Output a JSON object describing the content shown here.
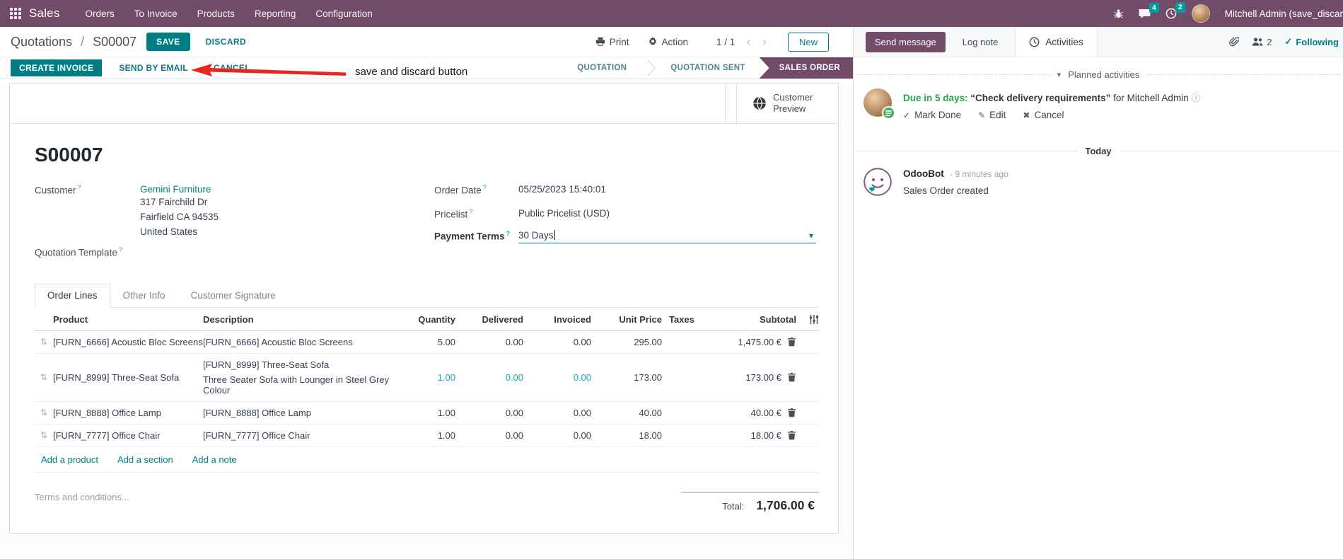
{
  "nav": {
    "app_name": "Sales",
    "menus": [
      "Orders",
      "To Invoice",
      "Products",
      "Reporting",
      "Configuration"
    ],
    "messages_badge": "4",
    "activities_badge": "2",
    "user_name": "Mitchell Admin (save_discar"
  },
  "control_panel": {
    "breadcrumb": {
      "parent": "Quotations",
      "separator": "/",
      "current": "S00007"
    },
    "save_label": "SAVE",
    "discard_label": "DISCARD",
    "annotation_text": "save and discard button",
    "print_label": "Print",
    "action_label": "Action",
    "pager_value": "1 / 1",
    "new_label": "New"
  },
  "statusbar": {
    "create_invoice_label": "CREATE INVOICE",
    "send_by_email_label": "SEND BY EMAIL",
    "cancel_label": "CANCEL",
    "stages": [
      {
        "label": "QUOTATION",
        "active": false
      },
      {
        "label": "QUOTATION SENT",
        "active": false
      },
      {
        "label": "SALES ORDER",
        "active": true
      }
    ]
  },
  "sheet": {
    "customer_preview_label": "Customer Preview",
    "record_name": "S00007",
    "help_marker": "?",
    "left_fields": {
      "customer_label": "Customer",
      "customer_value": "Gemini Furniture",
      "address": [
        "317 Fairchild Dr",
        "Fairfield CA 94535",
        "United States"
      ],
      "quotation_template_label": "Quotation Template"
    },
    "right_fields": {
      "order_date_label": "Order Date",
      "order_date_value": "05/25/2023 15:40:01",
      "pricelist_label": "Pricelist",
      "pricelist_value": "Public Pricelist (USD)",
      "payment_terms_label": "Payment Terms",
      "payment_terms_value": "30 Days"
    },
    "tabs": [
      {
        "label": "Order Lines",
        "active": true
      },
      {
        "label": "Other Info",
        "active": false
      },
      {
        "label": "Customer Signature",
        "active": false
      }
    ],
    "order_lines": {
      "col_product": "Product",
      "col_description": "Description",
      "col_quantity": "Quantity",
      "col_delivered": "Delivered",
      "col_invoiced": "Invoiced",
      "col_unit_price": "Unit Price",
      "col_taxes": "Taxes",
      "col_subtotal": "Subtotal",
      "rows": [
        {
          "product": "[FURN_6666] Acoustic Bloc Screens",
          "description": "[FURN_6666] Acoustic Bloc Screens",
          "description2": "",
          "quantity": "5.00",
          "delivered": "0.00",
          "invoiced": "0.00",
          "unit_price": "295.00",
          "taxes": "",
          "subtotal": "1,475.00 €"
        },
        {
          "product": "[FURN_8999] Three-Seat Sofa",
          "description": "[FURN_8999] Three-Seat Sofa",
          "description2": "Three Seater Sofa with Lounger in Steel Grey Colour",
          "quantity": "1.00",
          "delivered": "0.00",
          "invoiced": "0.00",
          "unit_price": "173.00",
          "taxes": "",
          "subtotal": "173.00 €"
        },
        {
          "product": "[FURN_8888] Office Lamp",
          "description": "[FURN_8888] Office Lamp",
          "description2": "",
          "quantity": "1.00",
          "delivered": "0.00",
          "invoiced": "0.00",
          "unit_price": "40.00",
          "taxes": "",
          "subtotal": "40.00 €"
        },
        {
          "product": "[FURN_7777] Office Chair",
          "description": "[FURN_7777] Office Chair",
          "description2": "",
          "quantity": "1.00",
          "delivered": "0.00",
          "invoiced": "0.00",
          "unit_price": "18.00",
          "taxes": "",
          "subtotal": "18.00 €"
        }
      ],
      "add_links": [
        "Add a product",
        "Add a section",
        "Add a note"
      ]
    },
    "terms_placeholder": "Terms and conditions...",
    "total_label": "Total:",
    "total_value": "1,706.00 €"
  },
  "chatter": {
    "send_message_label": "Send message",
    "log_note_label": "Log note",
    "activities_tab_label": "Activities",
    "followers_count": "2",
    "following_label": "Following",
    "planned_activities_header": "Planned activities",
    "activity": {
      "due_label": "Due in 5 days:",
      "summary": "“Check delivery requirements”",
      "assignee": "for Mitchell Admin",
      "mark_done_label": "Mark Done",
      "edit_label": "Edit",
      "cancel_label": "Cancel"
    },
    "today_separator": "Today",
    "message": {
      "author": "OdooBot",
      "time_ago": "- 9 minutes ago",
      "body": "Sales Order created"
    }
  },
  "icons_glyphs": {
    "dropdown_caret": "▾",
    "collapse_caret": "▾",
    "check": "✓",
    "pencil": "✎",
    "x_mark": "✖",
    "info": "ⓘ",
    "pager_prev": "‹",
    "pager_next": "›",
    "drag_handle": "⇅"
  },
  "colors": {
    "brand_purple": "#714B67",
    "accent_teal": "#017E84",
    "badge_teal": "#00A09D",
    "activity_green": "#28a745",
    "modified_cyan": "#17a2b8",
    "annotation_red": "#e8261d"
  }
}
